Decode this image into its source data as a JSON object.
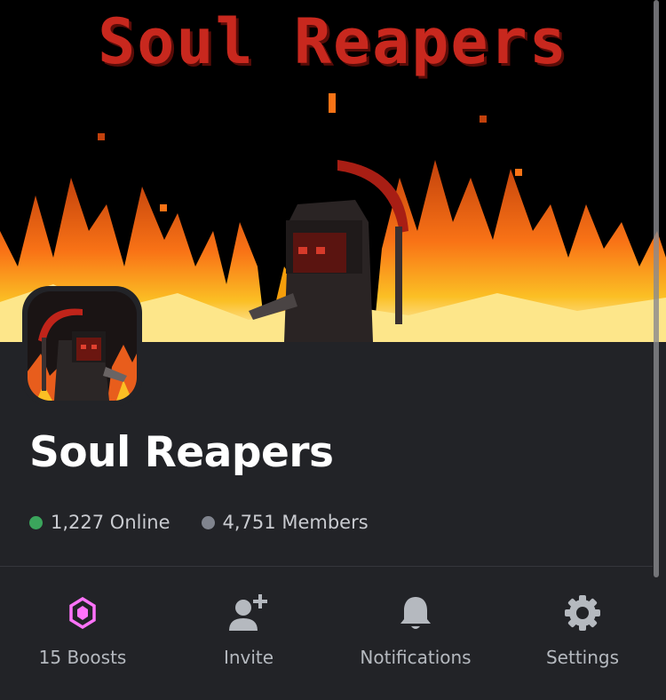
{
  "banner": {
    "title": "Soul Reapers"
  },
  "server": {
    "name": "Soul Reapers",
    "online": "1,227 Online",
    "members": "4,751 Members"
  },
  "colors": {
    "online": "#3ba55c",
    "members": "#80848e",
    "boost": "#ff73fa",
    "icon_gray": "#b5b9bf"
  },
  "actions": [
    {
      "label": "15 Boosts",
      "icon": "boost-gem-icon"
    },
    {
      "label": "Invite",
      "icon": "add-user-icon"
    },
    {
      "label": "Notifications",
      "icon": "bell-icon"
    },
    {
      "label": "Settings",
      "icon": "gear-icon"
    }
  ]
}
